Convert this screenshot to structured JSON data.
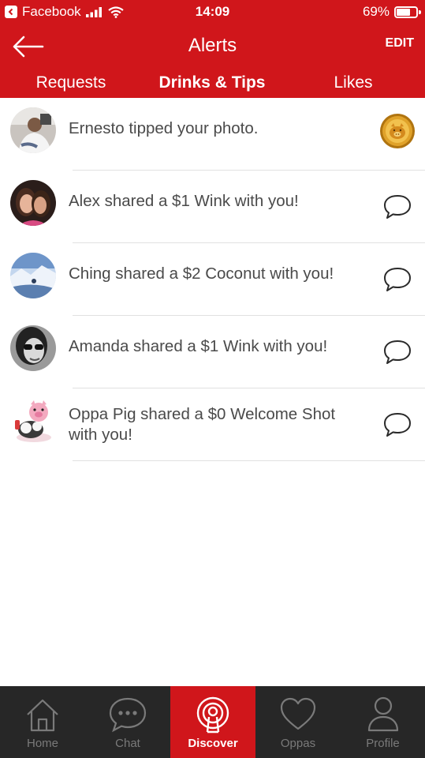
{
  "status_bar": {
    "back_app": "Facebook",
    "time": "14:09",
    "battery": "69%",
    "battery_level": 0.69
  },
  "nav": {
    "title": "Alerts",
    "edit_label": "EDIT"
  },
  "tabs": [
    {
      "label": "Requests",
      "active": false
    },
    {
      "label": "Drinks & Tips",
      "active": true
    },
    {
      "label": "Likes",
      "active": false
    }
  ],
  "alerts": [
    {
      "text": "Ernesto tipped your photo.",
      "action_icon": "gold-coin-icon"
    },
    {
      "text": "Alex shared a $1 Wink with you!",
      "action_icon": "chat-bubble-icon"
    },
    {
      "text": "Ching shared a $2 Coconut with you!",
      "action_icon": "chat-bubble-icon"
    },
    {
      "text": "Amanda shared a $1 Wink with you!",
      "action_icon": "chat-bubble-icon"
    },
    {
      "text": "Oppa Pig shared a $0 Welcome Shot with you!",
      "action_icon": "chat-bubble-icon"
    }
  ],
  "tabbar": [
    {
      "label": "Home",
      "icon": "home-icon",
      "active": false
    },
    {
      "label": "Chat",
      "icon": "chat-icon",
      "active": false
    },
    {
      "label": "Discover",
      "icon": "discover-icon",
      "active": true
    },
    {
      "label": "Oppas",
      "icon": "heart-icon",
      "active": false
    },
    {
      "label": "Profile",
      "icon": "profile-icon",
      "active": false
    }
  ],
  "colors": {
    "brand_red": "#d0161b",
    "tabbar_bg": "#272727",
    "text": "#4a4a4a",
    "divider": "#e1e1e1"
  }
}
